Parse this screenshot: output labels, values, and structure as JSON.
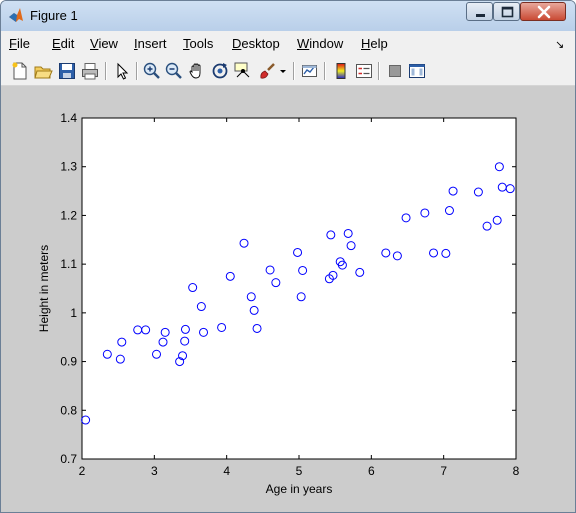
{
  "window": {
    "title": "Figure 1",
    "controls": [
      "minimize",
      "maximize",
      "close"
    ]
  },
  "menubar": {
    "items": [
      "File",
      "Edit",
      "View",
      "Insert",
      "Tools",
      "Desktop",
      "Window",
      "Help"
    ],
    "underline": [
      "F",
      "E",
      "V",
      "I",
      "T",
      "D",
      "W",
      "H"
    ],
    "overflow_arrow": "↘"
  },
  "toolbar": {
    "icons": [
      "new-figure-icon",
      "open-file-icon",
      "save-icon",
      "print-icon",
      "edit-plot-arrow-icon",
      "zoom-in-icon",
      "zoom-out-icon",
      "pan-hand-icon",
      "rotate-3d-icon",
      "data-cursor-icon",
      "brush-icon",
      "brush-dropdown-icon",
      "link-plot-icon",
      "insert-colorbar-icon",
      "insert-legend-icon",
      "hide-plot-tools-icon",
      "show-plot-tools-icon"
    ]
  },
  "colors": {
    "marker": "#0000ff",
    "figure_background": "#cccccc",
    "axes_background": "#ffffff"
  },
  "chart_data": {
    "type": "scatter",
    "xlabel": "Age in years",
    "ylabel": "Height in meters",
    "xlim": [
      2,
      8
    ],
    "ylim": [
      0.7,
      1.4
    ],
    "xticks": [
      "2",
      "3",
      "4",
      "5",
      "6",
      "7",
      "8"
    ],
    "yticks": [
      "0.7",
      "0.8",
      "0.9",
      "1",
      "1.1",
      "1.2",
      "1.3",
      "1.4"
    ],
    "marker": "circle",
    "grid": false,
    "points": [
      [
        2.05,
        0.78
      ],
      [
        2.35,
        0.915
      ],
      [
        2.53,
        0.905
      ],
      [
        2.55,
        0.94
      ],
      [
        2.77,
        0.965
      ],
      [
        2.88,
        0.965
      ],
      [
        3.03,
        0.915
      ],
      [
        3.12,
        0.94
      ],
      [
        3.15,
        0.96
      ],
      [
        3.35,
        0.9
      ],
      [
        3.39,
        0.912
      ],
      [
        3.42,
        0.942
      ],
      [
        3.43,
        0.966
      ],
      [
        3.53,
        1.052
      ],
      [
        3.65,
        1.013
      ],
      [
        3.68,
        0.96
      ],
      [
        3.93,
        0.97
      ],
      [
        4.05,
        1.075
      ],
      [
        4.24,
        1.143
      ],
      [
        4.34,
        1.033
      ],
      [
        4.38,
        1.005
      ],
      [
        4.42,
        0.968
      ],
      [
        4.6,
        1.088
      ],
      [
        4.68,
        1.062
      ],
      [
        4.98,
        1.124
      ],
      [
        5.03,
        1.033
      ],
      [
        5.05,
        1.087
      ],
      [
        5.42,
        1.07
      ],
      [
        5.44,
        1.16
      ],
      [
        5.47,
        1.077
      ],
      [
        5.57,
        1.105
      ],
      [
        5.6,
        1.098
      ],
      [
        5.68,
        1.163
      ],
      [
        5.72,
        1.138
      ],
      [
        5.84,
        1.083
      ],
      [
        6.2,
        1.123
      ],
      [
        6.36,
        1.117
      ],
      [
        6.48,
        1.195
      ],
      [
        6.74,
        1.205
      ],
      [
        6.86,
        1.123
      ],
      [
        7.03,
        1.122
      ],
      [
        7.08,
        1.21
      ],
      [
        7.13,
        1.25
      ],
      [
        7.48,
        1.248
      ],
      [
        7.6,
        1.178
      ],
      [
        7.74,
        1.19
      ],
      [
        7.77,
        1.3
      ],
      [
        7.81,
        1.258
      ],
      [
        7.92,
        1.255
      ]
    ]
  }
}
